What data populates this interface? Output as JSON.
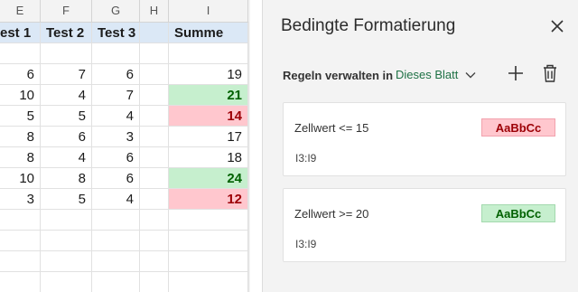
{
  "sheet": {
    "columns": [
      "E",
      "F",
      "G",
      "H",
      "I"
    ],
    "header_row": [
      "est 1",
      "Test 2",
      "Test 3",
      "",
      "Summe"
    ],
    "rows": [
      [
        "",
        "",
        "",
        "",
        ""
      ],
      [
        "6",
        "7",
        "6",
        "",
        "19"
      ],
      [
        "10",
        "4",
        "7",
        "",
        "21"
      ],
      [
        "5",
        "5",
        "4",
        "",
        "14"
      ],
      [
        "8",
        "6",
        "3",
        "",
        "17"
      ],
      [
        "8",
        "4",
        "6",
        "",
        "18"
      ],
      [
        "10",
        "8",
        "6",
        "",
        "24"
      ],
      [
        "3",
        "5",
        "4",
        "",
        "12"
      ],
      [
        "",
        "",
        "",
        "",
        ""
      ],
      [
        "",
        "",
        "",
        "",
        ""
      ],
      [
        "",
        "",
        "",
        "",
        ""
      ],
      [
        "",
        "",
        "",
        "",
        ""
      ]
    ],
    "highlight": {
      "2": "green",
      "3": "red",
      "6": "green",
      "7": "red"
    }
  },
  "pane": {
    "title": "Bedingte Formatierung",
    "manage_label": "Regeln verwalten in",
    "scope_value": "Dieses Blatt",
    "rules": [
      {
        "condition": "Zellwert <= 15",
        "preview": "AaBbCc",
        "range": "I3:I9",
        "style": "red"
      },
      {
        "condition": "Zellwert >= 20",
        "preview": "AaBbCc",
        "range": "I3:I9",
        "style": "green"
      }
    ]
  },
  "colors": {
    "accent": "#1e7145",
    "good_fill": "#c6efce",
    "good_text": "#006100",
    "bad_fill": "#ffc7ce",
    "bad_text": "#9c0006"
  },
  "icons": {
    "close": "close-icon",
    "chevron": "chevron-down-icon",
    "add": "plus-icon",
    "delete": "trash-icon"
  }
}
